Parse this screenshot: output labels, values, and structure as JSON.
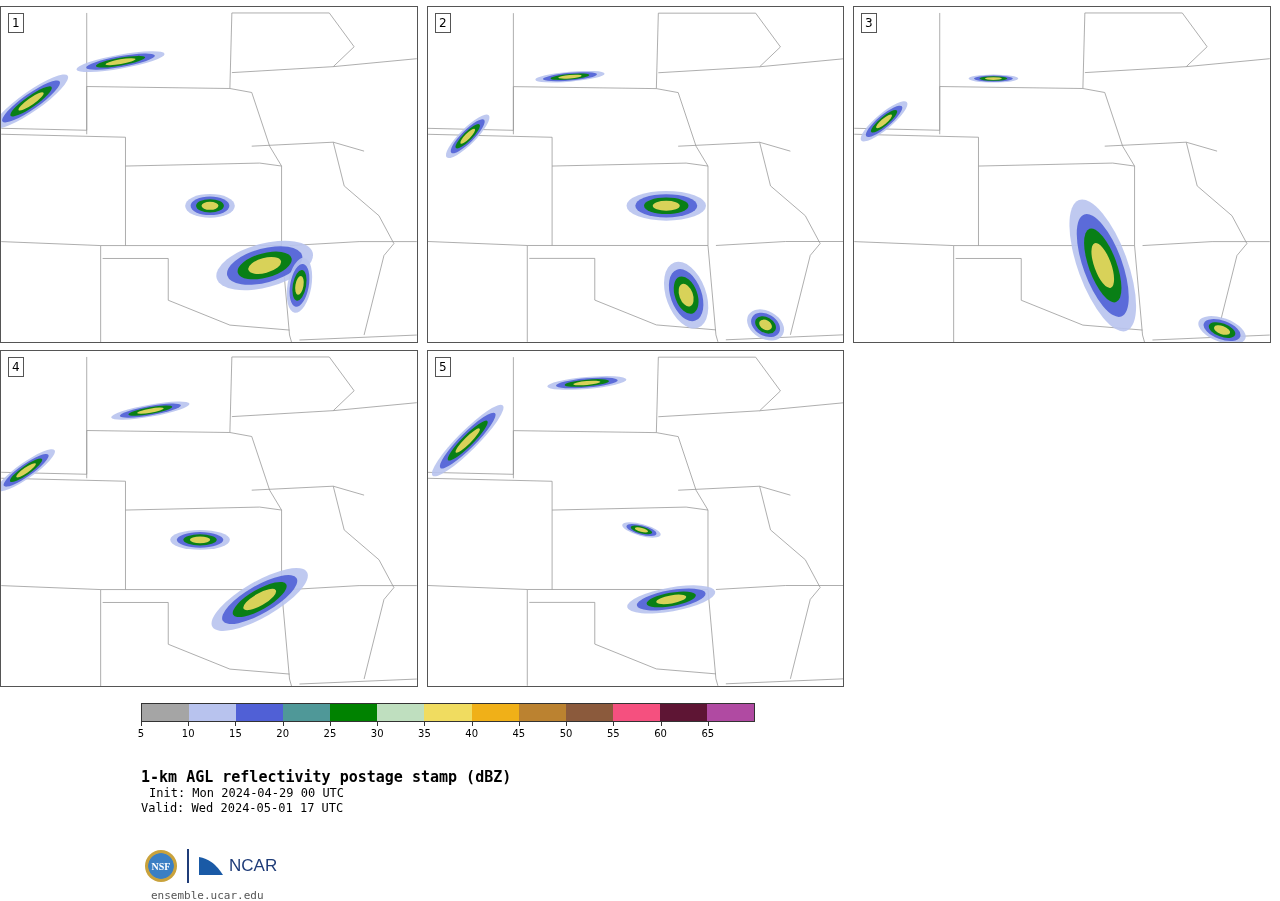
{
  "panels": [
    {
      "label": "1"
    },
    {
      "label": "2"
    },
    {
      "label": "3"
    },
    {
      "label": "4"
    },
    {
      "label": "5"
    }
  ],
  "colorbar": {
    "bins": [
      {
        "label": "5",
        "color": "#a5a5a5"
      },
      {
        "label": "10",
        "color": "#b8c3ee"
      },
      {
        "label": "15",
        "color": "#5060d6"
      },
      {
        "label": "20",
        "color": "#4f9898"
      },
      {
        "label": "25",
        "color": "#008200"
      },
      {
        "label": "30",
        "color": "#bfdfbf"
      },
      {
        "label": "35",
        "color": "#f0dc60"
      },
      {
        "label": "40",
        "color": "#f0b018"
      },
      {
        "label": "45",
        "color": "#bb8230"
      },
      {
        "label": "50",
        "color": "#8b5a3c"
      },
      {
        "label": "55",
        "color": "#f5507f"
      },
      {
        "label": "60",
        "color": "#5e1534"
      },
      {
        "label": "65",
        "color": "#b04aa2"
      }
    ]
  },
  "title": "1-km AGL reflectivity postage stamp (dBZ)",
  "init": "Init: Mon 2024-04-29 00 UTC",
  "valid": "Valid: Wed 2024-05-01 17 UTC",
  "logo": {
    "nsf": "NSF",
    "ncar": "NCAR"
  },
  "footer": "ensemble.ucar.edu"
}
